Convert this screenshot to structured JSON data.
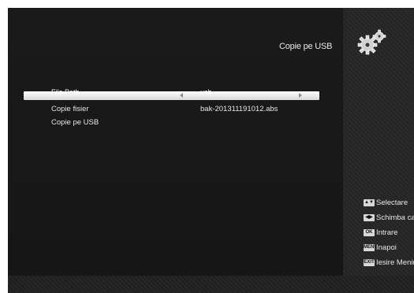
{
  "header": {
    "title": "Copie pe USB"
  },
  "menu": {
    "items": [
      {
        "label": "File Path",
        "value": "usb",
        "selected": true
      },
      {
        "label": "Copie fisier",
        "value": "bak-201311191012.abs",
        "selected": false
      },
      {
        "label": "Copie pe USB",
        "value": "",
        "selected": false
      }
    ]
  },
  "help": {
    "items": [
      {
        "key": "▲▼",
        "key_icon": "up-down-keys-icon",
        "label": "Selectare"
      },
      {
        "key": "◀▶",
        "key_icon": "left-right-keys-icon",
        "label": "Schimba cadru"
      },
      {
        "key": "OK",
        "key_icon": "ok-key-icon",
        "label": "Intrare"
      },
      {
        "key": "MENU",
        "key_icon": "menu-key-icon",
        "label": "Inapoi"
      },
      {
        "key": "EXIT",
        "key_icon": "exit-key-icon",
        "label": "Iesire Meniu"
      }
    ]
  },
  "colors": {
    "background": "#121212",
    "panel": "#1a1a1a",
    "text": "#e8e8e8",
    "highlight": "#ffffff"
  },
  "icons": {
    "header_icon": "gears-icon"
  }
}
